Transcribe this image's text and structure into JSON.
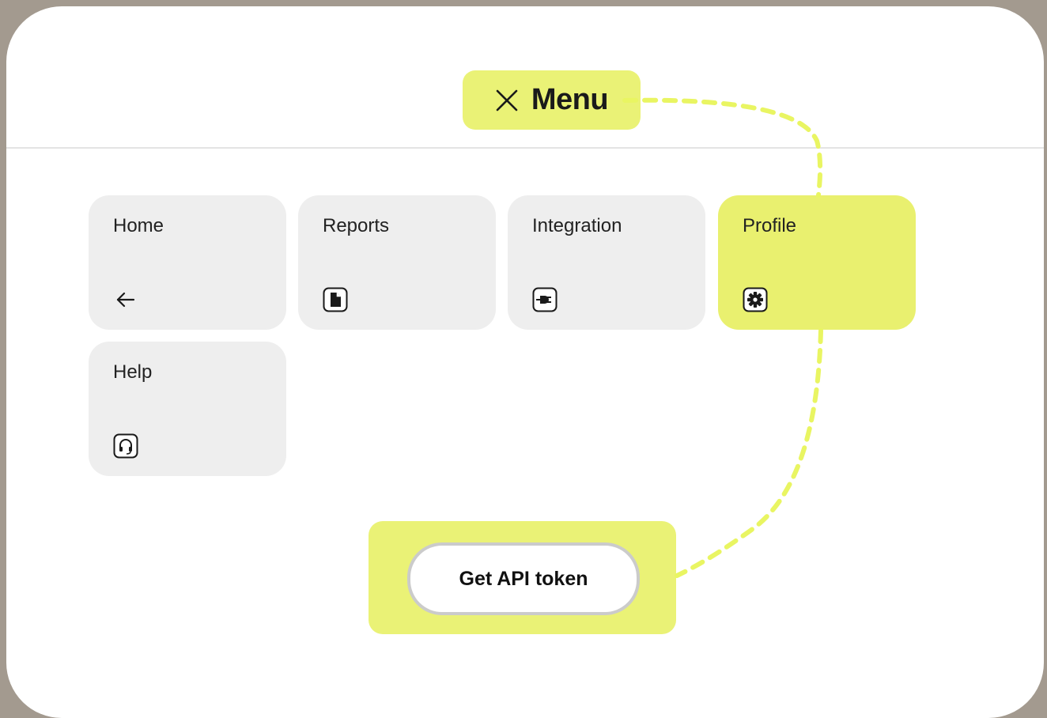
{
  "menu": {
    "label": "Menu",
    "close_icon": "close-icon"
  },
  "tiles": [
    {
      "label": "Home",
      "icon": "arrow-left-icon",
      "active": false
    },
    {
      "label": "Reports",
      "icon": "document-icon",
      "active": false
    },
    {
      "label": "Integration",
      "icon": "plug-icon",
      "active": false
    },
    {
      "label": "Profile",
      "icon": "gear-icon",
      "active": true
    },
    {
      "label": "Help",
      "icon": "headset-icon",
      "active": false
    }
  ],
  "token": {
    "button_label": "Get API token"
  },
  "colors": {
    "accent": "#eaf276",
    "tile": "#eeeeee",
    "backdrop": "#a39a8f",
    "connector": "#e9f562"
  }
}
